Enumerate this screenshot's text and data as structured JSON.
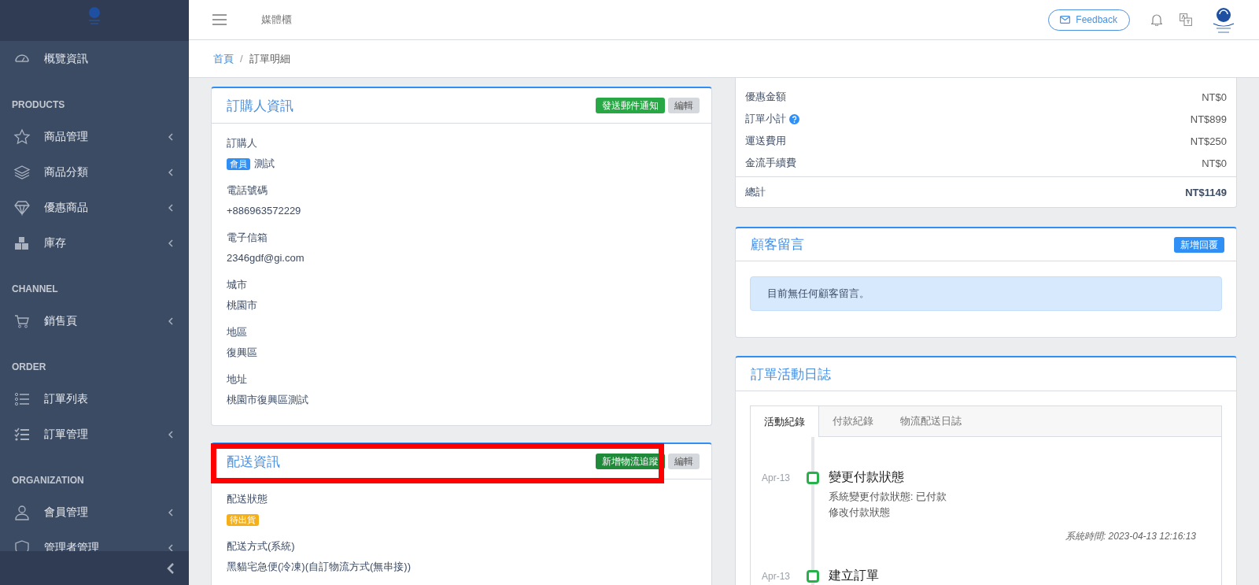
{
  "sidebar": {
    "items": [
      {
        "kind": "link",
        "label": "概覽資訊",
        "expandable": false
      },
      {
        "kind": "section",
        "label": "PRODUCTS"
      },
      {
        "kind": "link",
        "label": "商品管理",
        "expandable": true
      },
      {
        "kind": "link",
        "label": "商品分類",
        "expandable": true
      },
      {
        "kind": "link",
        "label": "優惠商品",
        "expandable": true
      },
      {
        "kind": "link",
        "label": "庫存",
        "expandable": true
      },
      {
        "kind": "section",
        "label": "CHANNEL"
      },
      {
        "kind": "link",
        "label": "銷售頁",
        "expandable": true
      },
      {
        "kind": "section",
        "label": "ORDER"
      },
      {
        "kind": "link",
        "label": "訂單列表",
        "expandable": false
      },
      {
        "kind": "link",
        "label": "訂單管理",
        "expandable": true
      },
      {
        "kind": "section",
        "label": "ORGANIZATION"
      },
      {
        "kind": "link",
        "label": "會員管理",
        "expandable": true
      },
      {
        "kind": "link",
        "label": "管理者管理",
        "expandable": true
      }
    ]
  },
  "topbar": {
    "title": "媒體櫃",
    "feedback": "Feedback"
  },
  "breadcrumb": {
    "separator": "/",
    "items": [
      {
        "label": "首頁",
        "link": true
      },
      {
        "label": "訂單明細",
        "link": false
      }
    ]
  },
  "buyer_card": {
    "title": "訂購人資訊",
    "highlighted": false,
    "buttons": [
      {
        "label": "發送郵件通知"
      },
      {
        "label": "編輯"
      }
    ],
    "fields": [
      {
        "label": "訂購人",
        "badge": {
          "text": "會員",
          "color": "#2f8ff5"
        },
        "value": "測試"
      },
      {
        "label": "電話號碼",
        "value": "+886963572229"
      },
      {
        "label": "電子信箱",
        "value": "2346gdf@gi.com"
      },
      {
        "label": "城市",
        "value": "桃園市"
      },
      {
        "label": "地區",
        "value": "復興區"
      },
      {
        "label": "地址",
        "value": "桃園市復興區測試"
      }
    ]
  },
  "shipping_card": {
    "title": "配送資訊",
    "highlighted": true,
    "buttons": [
      {
        "label": "新增物流追蹤"
      },
      {
        "label": "編輯"
      }
    ],
    "fields": [
      {
        "label": "配送狀態",
        "badge": {
          "text": "待出貨",
          "color": "#f5b019"
        }
      },
      {
        "label": "配送方式(系統)",
        "value": "黑貓宅急便(冷凍)(自訂物流方式(無串接))"
      }
    ]
  },
  "summary": {
    "rows": [
      {
        "label": "優惠金額",
        "value": "NT$0",
        "help": false
      },
      {
        "label": "訂單小計",
        "value": "NT$899",
        "help": true
      },
      {
        "label": "運送費用",
        "value": "NT$250",
        "help": false
      },
      {
        "label": "金流手續費",
        "value": "NT$0",
        "help": false
      }
    ],
    "total": {
      "label": "總計",
      "value": "NT$1149"
    }
  },
  "comments": {
    "title": "顧客留言",
    "button": {
      "label": "新增回覆"
    },
    "notice": "目前無任何顧客留言。"
  },
  "activity": {
    "title": "訂單活動日誌",
    "tabs": [
      {
        "label": "活動紀錄",
        "selected": true
      },
      {
        "label": "付款紀錄",
        "selected": false
      },
      {
        "label": "物流配送日誌",
        "selected": false
      }
    ],
    "entries": [
      {
        "date": "Apr-13",
        "title": "變更付款狀態",
        "lines": [
          "系統變更付款狀態: 已付款",
          "修改付款狀態"
        ],
        "timestamp": "系統時間: 2023-04-13 12:16:13"
      },
      {
        "date": "Apr-13",
        "title": "建立訂單"
      }
    ]
  }
}
